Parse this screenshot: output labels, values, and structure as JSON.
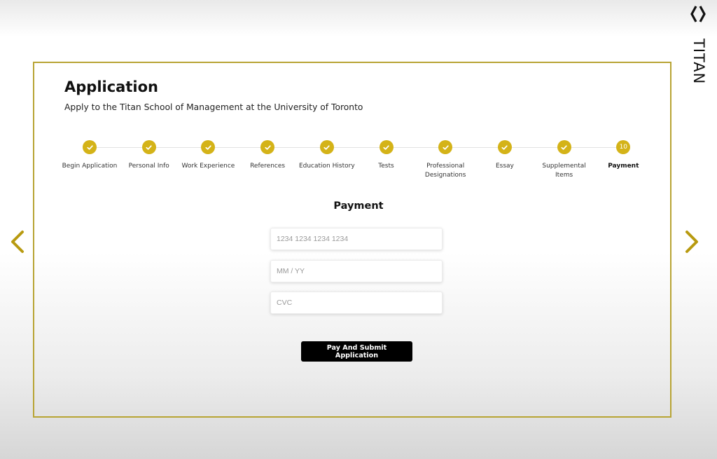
{
  "brand": {
    "name": "TITAN",
    "accent_color": "#d4b318"
  },
  "header": {
    "title": "Application",
    "subtitle": "Apply to the Titan School of Management at the University of Toronto"
  },
  "stepper": {
    "steps": [
      {
        "label": "Begin Application",
        "status": "completed",
        "icon": "check-icon"
      },
      {
        "label": "Personal Info",
        "status": "completed",
        "icon": "check-icon"
      },
      {
        "label": "Work Experience",
        "status": "completed",
        "icon": "check-icon"
      },
      {
        "label": "References",
        "status": "completed",
        "icon": "check-icon"
      },
      {
        "label": "Education History",
        "status": "completed",
        "icon": "check-icon"
      },
      {
        "label": "Tests",
        "status": "completed",
        "icon": "check-icon"
      },
      {
        "label": "Professional Designations",
        "status": "completed",
        "icon": "check-icon"
      },
      {
        "label": "Essay",
        "status": "completed",
        "icon": "check-icon"
      },
      {
        "label": "Supplemental Items",
        "status": "completed",
        "icon": "check-icon"
      },
      {
        "label": "Payment",
        "status": "active",
        "number": "10"
      }
    ]
  },
  "payment": {
    "title": "Payment",
    "card_number": {
      "value": "",
      "placeholder": "1234 1234 1234 1234"
    },
    "expiry": {
      "value": "",
      "placeholder": "MM / YY"
    },
    "cvc": {
      "value": "",
      "placeholder": "CVC"
    },
    "submit_label": "Pay And Submit Application"
  },
  "navigation": {
    "prev_icon": "chevron-left-icon",
    "next_icon": "chevron-right-icon"
  }
}
